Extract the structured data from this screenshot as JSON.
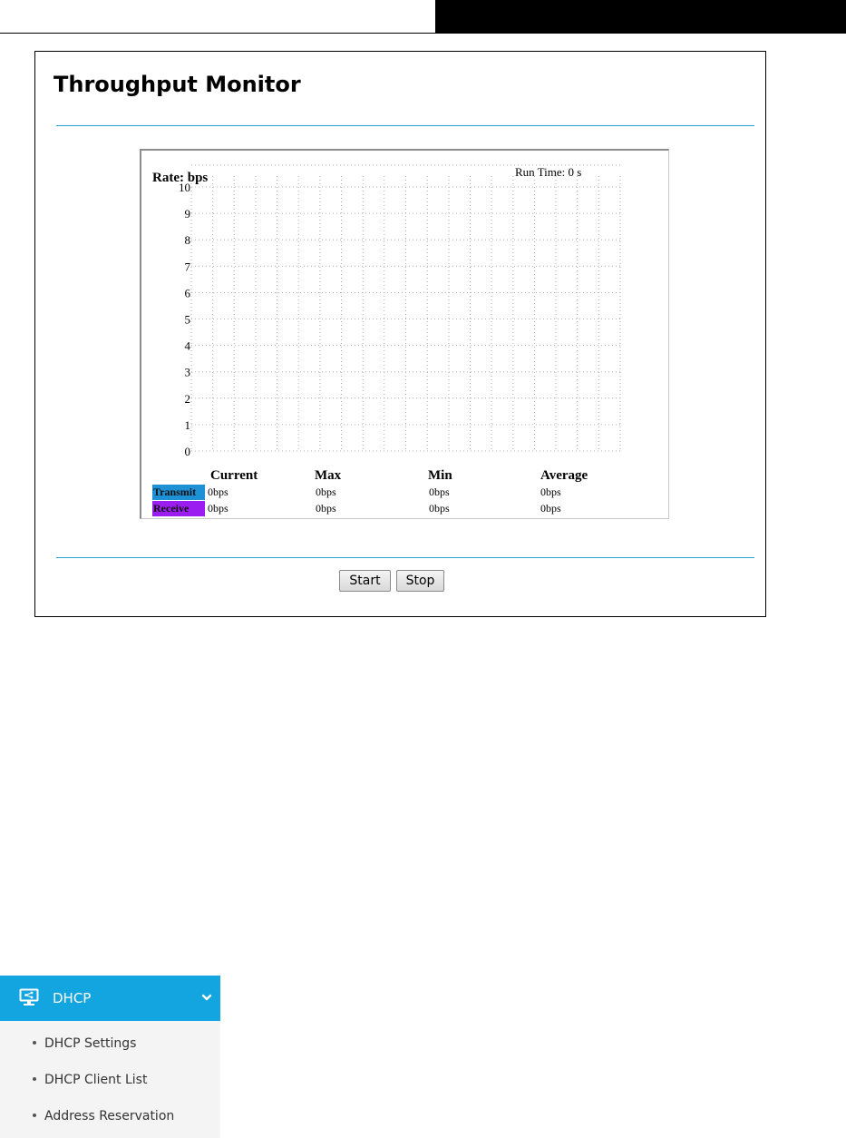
{
  "panel": {
    "title": "Throughput Monitor",
    "rate_label": "Rate: bps",
    "run_time_label": "Run Time:",
    "run_time_value": "0",
    "run_time_unit": "s"
  },
  "chart_data": {
    "type": "line",
    "ylabel": "Rate: bps",
    "ylim": [
      0,
      10
    ],
    "y_ticks": [
      "0",
      "1",
      "2",
      "3",
      "4",
      "5",
      "6",
      "7",
      "8",
      "9",
      "10"
    ],
    "grid": true,
    "series": [
      {
        "name": "Transmit",
        "color": "#1e90d6",
        "values": []
      },
      {
        "name": "Receive",
        "color": "#9b1df0",
        "values": []
      }
    ]
  },
  "stats": {
    "headers": [
      "Current",
      "Max",
      "Min",
      "Average"
    ],
    "rows": [
      {
        "label": "Transmit",
        "values": [
          "0bps",
          "0bps",
          "0bps",
          "0bps"
        ]
      },
      {
        "label": "Receive",
        "values": [
          "0bps",
          "0bps",
          "0bps",
          "0bps"
        ]
      }
    ]
  },
  "buttons": {
    "start": "Start",
    "stop": "Stop"
  },
  "menu": {
    "title": "DHCP",
    "icon": "monitor-share-icon",
    "accent": "#12a5e0",
    "items": [
      "DHCP Settings",
      "DHCP Client List",
      "Address Reservation"
    ]
  }
}
